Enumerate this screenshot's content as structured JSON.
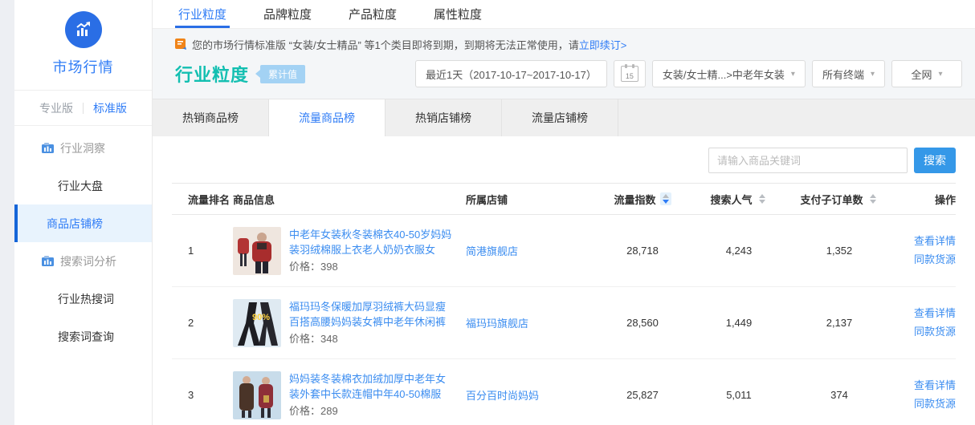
{
  "sidebar": {
    "app_title": "市场行情",
    "versions": [
      {
        "label": "专业版",
        "active": false
      },
      {
        "label": "标准版",
        "active": true
      }
    ],
    "menu": {
      "industry_insight": "行业洞察",
      "industry_board": "行业大盘",
      "product_shop_rank": "商品店铺榜",
      "search_word_analysis": "搜索词分析",
      "industry_hot_words": "行业热搜词",
      "search_word_query": "搜索词查询"
    }
  },
  "top_tabs": {
    "industry": "行业粒度",
    "brand": "品牌粒度",
    "product": "产品粒度",
    "attribute": "属性粒度"
  },
  "notice": {
    "text": "您的市场行情标准版 “女装/女士精品” 等1个类目即将到期，到期将无法正常使用，请",
    "link": "立即续订>"
  },
  "page": {
    "title": "行业粒度",
    "badge": "累计值"
  },
  "filters": {
    "date_range": "最近1天（2017-10-17~2017-10-17）",
    "calendar_day": "15",
    "category": "女装/女士精...>中老年女装",
    "terminal": "所有终端",
    "network": "全网"
  },
  "rank_tabs": {
    "hot_product": "热销商品榜",
    "traffic_product": "流量商品榜",
    "hot_shop": "热销店铺榜",
    "traffic_shop": "流量店铺榜"
  },
  "search": {
    "placeholder": "请输入商品关键词",
    "button": "搜索"
  },
  "table": {
    "columns": {
      "rank": "流量排名",
      "product": "商品信息",
      "shop": "所属店铺",
      "traffic_index": "流量指数",
      "search_popularity": "搜索人气",
      "paid_sub_orders": "支付子订单数",
      "operation": "操作"
    },
    "rows": [
      {
        "rank": "1",
        "title": "中老年女装秋冬装棉衣40-50岁妈妈装羽绒棉服上衣老人奶奶衣服女",
        "price": "价格：398",
        "shop": "简港旗舰店",
        "traffic": "28,718",
        "search": "4,243",
        "orders": "1,352",
        "action1": "查看详情",
        "action2": "同款货源"
      },
      {
        "rank": "2",
        "title": "福玛玛冬保暖加厚羽绒裤大码显瘦百搭高腰妈妈装女裤中老年休闲裤",
        "price": "价格：348",
        "shop": "福玛玛旗舰店",
        "traffic": "28,560",
        "search": "1,449",
        "orders": "2,137",
        "action1": "查看详情",
        "action2": "同款货源"
      },
      {
        "rank": "3",
        "title": "妈妈装冬装棉衣加绒加厚中老年女装外套中长款连帽中年40-50棉服",
        "price": "价格：289",
        "shop": "百分百时尚妈妈",
        "traffic": "25,827",
        "search": "5,011",
        "orders": "374",
        "action1": "查看详情",
        "action2": "同款货源"
      }
    ]
  },
  "colors": {
    "accent_blue": "#2f7cf6",
    "title_teal": "#13bfb1",
    "button_blue": "#3598e8",
    "selected_bar": "#1565d8"
  }
}
